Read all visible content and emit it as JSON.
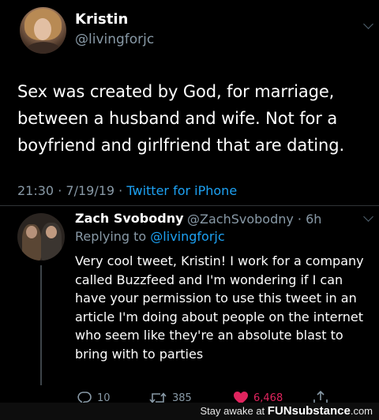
{
  "main_tweet": {
    "name": "Kristin",
    "handle": "@livingforjc",
    "text_lines": [
      "Sex was created by God, for marriage,",
      "between a husband and wife. Not for a",
      "boyfriend and girlfriend that are dating."
    ],
    "time": "21:30",
    "date": "7/19/19",
    "separator": "·",
    "source": "Twitter for iPhone"
  },
  "reply_tweet": {
    "name": "Zach Svobodny",
    "handle_time": "@ZachSvobodny · 6h",
    "replying_prefix": "Replying to",
    "replying_to": "@livingforjc",
    "text_lines": [
      "Very cool tweet, Kristin! I work for a company",
      "called Buzzfeed and I'm wondering if I can",
      "have your permission to use this tweet in an",
      "article I'm doing about people on the internet",
      "who seem like they're an absolute blast to",
      "bring with to parties"
    ],
    "actions": {
      "replies": "10",
      "retweets": "385",
      "likes": "6,468"
    }
  },
  "colors": {
    "background": "#000000",
    "secondary_text": "#8899a6",
    "link": "#1da1f2",
    "like": "#e0245e"
  },
  "icons": [
    "chevron-down-icon",
    "reply-icon",
    "retweet-icon",
    "heart-icon",
    "share-icon"
  ],
  "watermark": {
    "prefix": "Stay awake at",
    "brand": "FUNsubstance",
    "suffix": ".com"
  }
}
